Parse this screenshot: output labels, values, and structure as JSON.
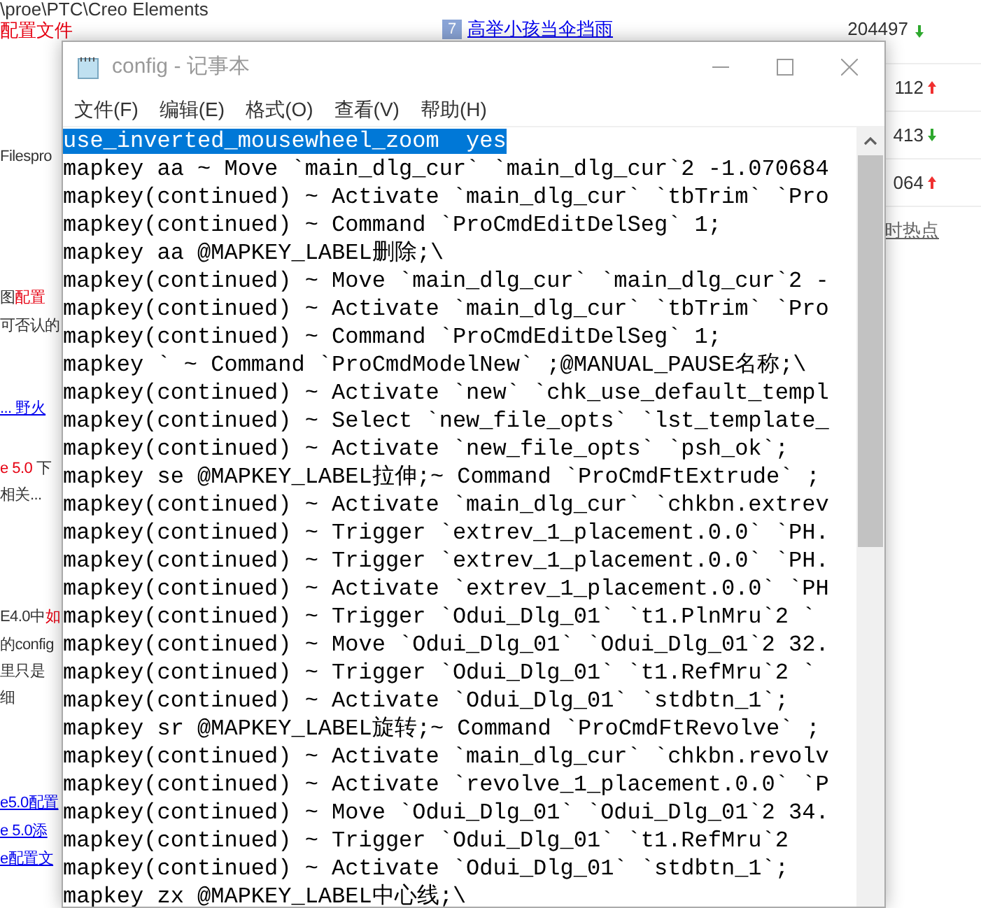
{
  "background_page": {
    "path": "\\proe\\PTC\\Creo Elements",
    "heading_parts": [
      {
        "text": "配置文件",
        "kind": "red"
      }
    ],
    "hot_list": {
      "top_item": {
        "rank": "7",
        "title": "高举小孩当伞挡雨",
        "count": "204497",
        "rising": false
      },
      "items": [
        {
          "count": "112",
          "rising": true
        },
        {
          "count": "413",
          "rising": false
        },
        {
          "count": "064",
          "rising": true
        }
      ],
      "more_link": "时热点"
    },
    "left_fragments": [
      {
        "parts": [
          {
            "text": "Filespro",
            "kind": "plain"
          }
        ]
      },
      {
        "parts": [
          {
            "text": "图",
            "kind": "plain"
          },
          {
            "text": "配置",
            "kind": "red"
          }
        ]
      },
      {
        "parts": [
          {
            "text": "可否认的",
            "kind": "plain"
          }
        ]
      },
      {
        "parts": [
          {
            "text": "... 野火",
            "kind": "link"
          }
        ]
      },
      {
        "parts": [
          {
            "text": "e 5.0",
            "kind": "red"
          },
          {
            "text": " 下",
            "kind": "plain"
          }
        ]
      },
      {
        "parts": [
          {
            "text": "相关...",
            "kind": "plain"
          }
        ]
      },
      {
        "parts": [
          {
            "text": "E4.0中",
            "kind": "plain"
          },
          {
            "text": "如",
            "kind": "red"
          }
        ]
      },
      {
        "parts": [
          {
            "text": "的config",
            "kind": "plain"
          }
        ]
      },
      {
        "parts": [
          {
            "text": "里只是",
            "kind": "plain"
          }
        ]
      },
      {
        "parts": [
          {
            "text": "细",
            "kind": "plain"
          }
        ]
      },
      {
        "parts": [
          {
            "text": "e5.0配置",
            "kind": "link"
          }
        ]
      },
      {
        "parts": [
          {
            "text": "e 5.0添",
            "kind": "link"
          }
        ]
      },
      {
        "parts": [
          {
            "text": "e配置文",
            "kind": "link"
          }
        ]
      }
    ]
  },
  "window": {
    "title": "config - 记事本",
    "menu": [
      "文件(F)",
      "编辑(E)",
      "格式(O)",
      "查看(V)",
      "帮助(H)"
    ],
    "lines": [
      {
        "text": "use_inverted_mousewheel_zoom  yes",
        "selected": true
      },
      {
        "text": "mapkey aa ~ Move `main_dlg_cur` `main_dlg_cur`2 -1.070684",
        "selected": false
      },
      {
        "text": "mapkey(continued) ~ Activate `main_dlg_cur` `tbTrim` `Pro",
        "selected": false
      },
      {
        "text": "mapkey(continued) ~ Command `ProCmdEditDelSeg` 1;",
        "selected": false
      },
      {
        "text": "mapkey aa @MAPKEY_LABEL删除;\\",
        "selected": false
      },
      {
        "text": "mapkey(continued) ~ Move `main_dlg_cur` `main_dlg_cur`2 -",
        "selected": false
      },
      {
        "text": "mapkey(continued) ~ Activate `main_dlg_cur` `tbTrim` `Pro",
        "selected": false
      },
      {
        "text": "mapkey(continued) ~ Command `ProCmdEditDelSeg` 1;",
        "selected": false
      },
      {
        "text": "mapkey ` ~ Command `ProCmdModelNew` ;@MANUAL_PAUSE名称;\\",
        "selected": false
      },
      {
        "text": "mapkey(continued) ~ Activate `new` `chk_use_default_templ",
        "selected": false
      },
      {
        "text": "mapkey(continued) ~ Select `new_file_opts` `lst_template_",
        "selected": false
      },
      {
        "text": "mapkey(continued) ~ Activate `new_file_opts` `psh_ok`;",
        "selected": false
      },
      {
        "text": "mapkey se @MAPKEY_LABEL拉伸;~ Command `ProCmdFtExtrude` ;",
        "selected": false
      },
      {
        "text": "mapkey(continued) ~ Activate `main_dlg_cur` `chkbn.extrev",
        "selected": false
      },
      {
        "text": "mapkey(continued) ~ Trigger `extrev_1_placement.0.0` `PH.",
        "selected": false
      },
      {
        "text": "mapkey(continued) ~ Trigger `extrev_1_placement.0.0` `PH.",
        "selected": false
      },
      {
        "text": "mapkey(continued) ~ Activate `extrev_1_placement.0.0` `PH",
        "selected": false
      },
      {
        "text": "mapkey(continued) ~ Trigger `Odui_Dlg_01` `t1.PlnMru`2 `",
        "selected": false
      },
      {
        "text": "mapkey(continued) ~ Move `Odui_Dlg_01` `Odui_Dlg_01`2 32.",
        "selected": false
      },
      {
        "text": "mapkey(continued) ~ Trigger `Odui_Dlg_01` `t1.RefMru`2 `",
        "selected": false
      },
      {
        "text": "mapkey(continued) ~ Activate `Odui_Dlg_01` `stdbtn_1`;",
        "selected": false
      },
      {
        "text": "mapkey sr @MAPKEY_LABEL旋转;~ Command `ProCmdFtRevolve` ;",
        "selected": false
      },
      {
        "text": "mapkey(continued) ~ Activate `main_dlg_cur` `chkbn.revolv",
        "selected": false
      },
      {
        "text": "mapkey(continued) ~ Activate `revolve_1_placement.0.0` `P",
        "selected": false
      },
      {
        "text": "mapkey(continued) ~ Move `Odui_Dlg_01` `Odui_Dlg_01`2 34.",
        "selected": false
      },
      {
        "text": "mapkey(continued) ~ Trigger `Odui_Dlg_01` `t1.RefMru`2",
        "selected": false
      },
      {
        "text": "mapkey(continued) ~ Activate `Odui_Dlg_01` `stdbtn_1`;",
        "selected": false
      },
      {
        "text": "mapkey zx @MAPKEY_LABEL中心线;\\",
        "selected": false
      }
    ]
  }
}
